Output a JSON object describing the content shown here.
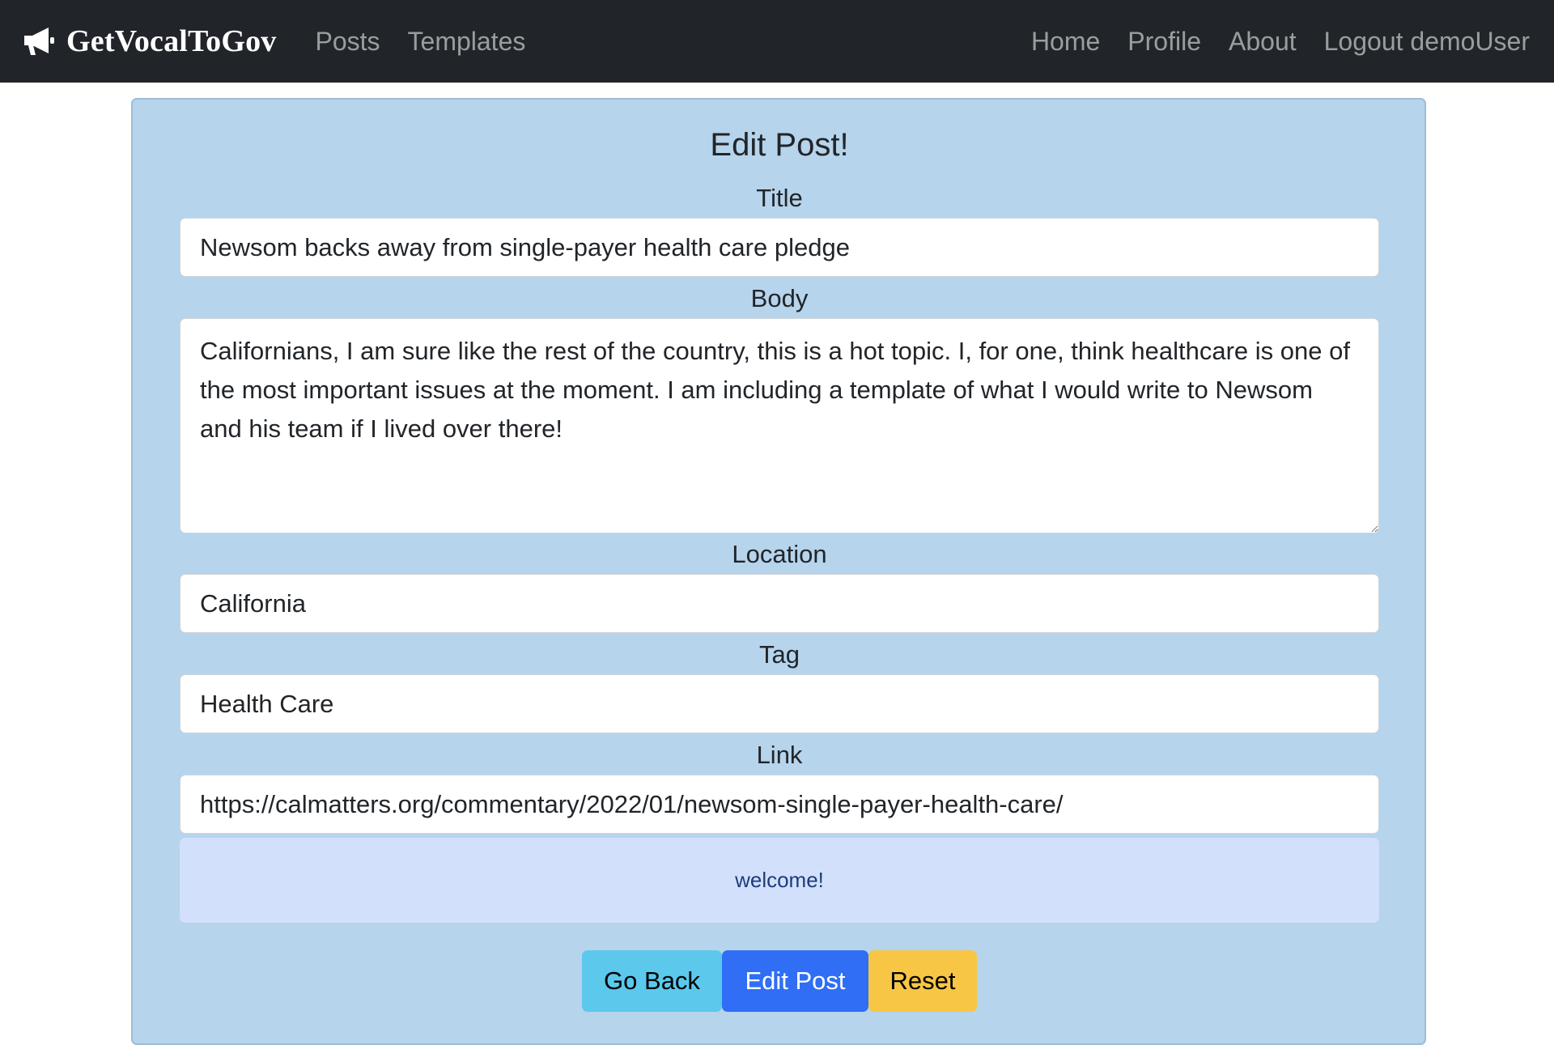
{
  "navbar": {
    "brand": "GetVocalToGov",
    "brand_icon": "megaphone-icon",
    "left_links": [
      "Posts",
      "Templates"
    ],
    "right_links": [
      "Home",
      "Profile",
      "About",
      "Logout demoUser"
    ]
  },
  "form": {
    "heading": "Edit Post!",
    "title_label": "Title",
    "title_value": "Newsom backs away from single-payer health care pledge",
    "body_label": "Body",
    "body_value": "Californians, I am sure like the rest of the country, this is a hot topic. I, for one, think healthcare is one of the most important issues at the moment. I am including a template of what I would write to Newsom and his team if I lived over there!",
    "location_label": "Location",
    "location_value": "California",
    "tag_label": "Tag",
    "tag_value": "Health Care",
    "link_label": "Link",
    "link_value": "https://calmatters.org/commentary/2022/01/newsom-single-payer-health-care/"
  },
  "alert": {
    "message": "welcome!"
  },
  "buttons": {
    "go_back": "Go Back",
    "edit_post": "Edit Post",
    "reset": "Reset"
  },
  "colors": {
    "navbar_bg": "#212529",
    "card_bg": "#b6d4ec",
    "alert_bg": "#d3e0fb",
    "btn_info": "#5bc8ec",
    "btn_primary": "#2f6ef5",
    "btn_warning": "#f7c644"
  }
}
